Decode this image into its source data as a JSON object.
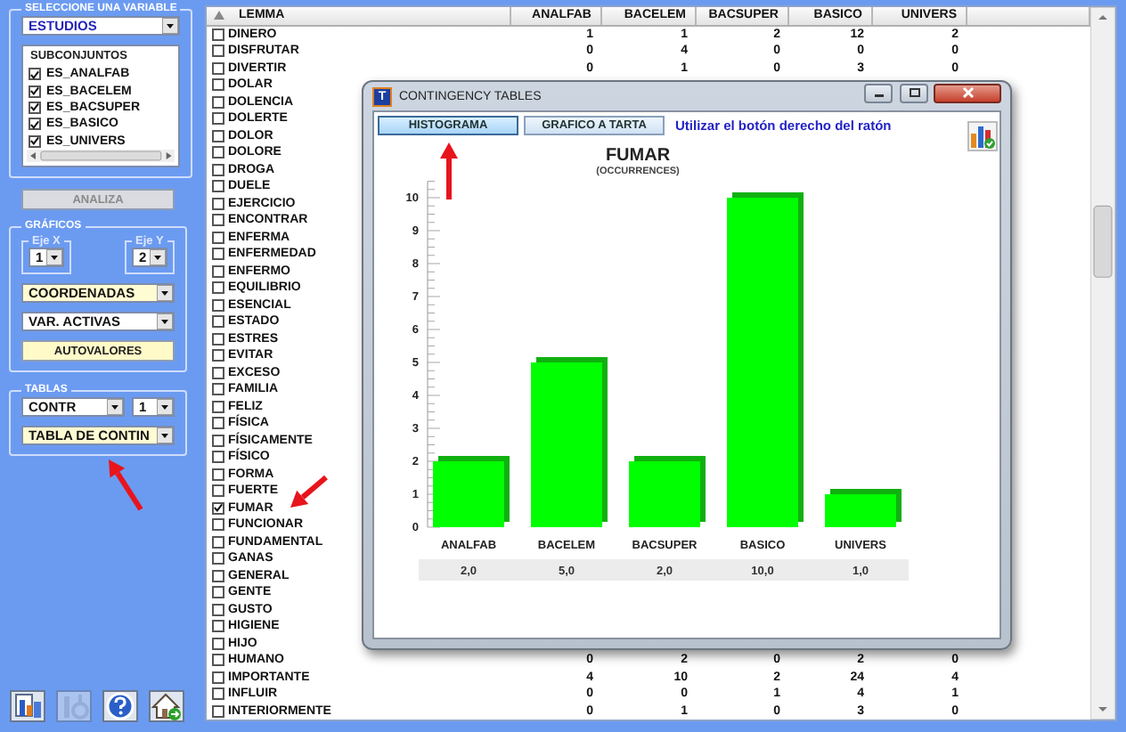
{
  "sidebar": {
    "variable_group": {
      "title": "SELECCIONE UNA VARIABLE",
      "variable": "ESTUDIOS",
      "subsets": {
        "header": "SUBCONJUNTOS",
        "items": [
          {
            "label": "ES_ANALFAB",
            "checked": true
          },
          {
            "label": "ES_BACELEM",
            "checked": true
          },
          {
            "label": "ES_BACSUPER",
            "checked": true
          },
          {
            "label": "ES_BASICO",
            "checked": true
          },
          {
            "label": "ES_UNIVERS",
            "checked": true
          }
        ]
      }
    },
    "analyze_button": {
      "label": "ANALIZA",
      "disabled": true
    },
    "charts_group": {
      "title": "GRÁFICOS",
      "axis_x": {
        "label": "Eje X",
        "value": "1"
      },
      "axis_y": {
        "label": "Eje Y",
        "value": "2"
      },
      "plot_type": {
        "value": "COORDENADAS",
        "highlighted": true
      },
      "variables": {
        "value": "VAR. ACTIVAS",
        "highlighted": false
      },
      "eigen_button": {
        "label": "AUTOVALORES"
      }
    },
    "tables_group": {
      "title": "TABLAS",
      "measure": {
        "value": "CONTR",
        "highlighted": false
      },
      "index": {
        "value": "1",
        "highlighted": false
      },
      "table_type": {
        "value": "TABLA DE CONTIN",
        "highlighted": true
      }
    },
    "toolbar": [
      {
        "kind": "export",
        "disabled": false
      },
      {
        "kind": "tool",
        "disabled": true
      },
      {
        "kind": "help",
        "disabled": false
      },
      {
        "kind": "home",
        "disabled": false
      }
    ]
  },
  "table": {
    "columns": [
      "LEMMA",
      "ANALFAB",
      "BACELEM",
      "BACSUPER",
      "BASICO",
      "UNIVERS"
    ],
    "rows": [
      {
        "lemma": "DINERO",
        "checked": false,
        "values": [
          "1",
          "1",
          "2",
          "12",
          "2"
        ]
      },
      {
        "lemma": "DISFRUTAR",
        "checked": false,
        "values": [
          "0",
          "4",
          "0",
          "0",
          "0"
        ]
      },
      {
        "lemma": "DIVERTIR",
        "checked": false,
        "values": [
          "0",
          "1",
          "0",
          "3",
          "0"
        ]
      },
      {
        "lemma": "DOLAR",
        "checked": false
      },
      {
        "lemma": "DOLENCIA",
        "checked": false
      },
      {
        "lemma": "DOLERTE",
        "checked": false
      },
      {
        "lemma": "DOLOR",
        "checked": false
      },
      {
        "lemma": "DOLORE",
        "checked": false
      },
      {
        "lemma": "DROGA",
        "checked": false
      },
      {
        "lemma": "DUELE",
        "checked": false
      },
      {
        "lemma": "EJERCICIO",
        "checked": false
      },
      {
        "lemma": "ENCONTRAR",
        "checked": false
      },
      {
        "lemma": "ENFERMA",
        "checked": false
      },
      {
        "lemma": "ENFERMEDAD",
        "checked": false
      },
      {
        "lemma": "ENFERMO",
        "checked": false
      },
      {
        "lemma": "EQUILIBRIO",
        "checked": false
      },
      {
        "lemma": "ESENCIAL",
        "checked": false
      },
      {
        "lemma": "ESTADO",
        "checked": false
      },
      {
        "lemma": "ESTRES",
        "checked": false
      },
      {
        "lemma": "EVITAR",
        "checked": false
      },
      {
        "lemma": "EXCESO",
        "checked": false
      },
      {
        "lemma": "FAMILIA",
        "checked": false
      },
      {
        "lemma": "FELIZ",
        "checked": false
      },
      {
        "lemma": "FÍSICA",
        "checked": false
      },
      {
        "lemma": "FÍSICAMENTE",
        "checked": false
      },
      {
        "lemma": "FÍSICO",
        "checked": false
      },
      {
        "lemma": "FORMA",
        "checked": false
      },
      {
        "lemma": "FUERTE",
        "checked": false
      },
      {
        "lemma": "FUMAR",
        "checked": true
      },
      {
        "lemma": "FUNCIONAR",
        "checked": false
      },
      {
        "lemma": "FUNDAMENTAL",
        "checked": false
      },
      {
        "lemma": "GANAS",
        "checked": false
      },
      {
        "lemma": "GENERAL",
        "checked": false
      },
      {
        "lemma": "GENTE",
        "checked": false
      },
      {
        "lemma": "GUSTO",
        "checked": false
      },
      {
        "lemma": "HIGIENE",
        "checked": false
      },
      {
        "lemma": "HIJO",
        "checked": false
      },
      {
        "lemma": "HUMANO",
        "checked": false,
        "values": [
          "0",
          "2",
          "0",
          "2",
          "0"
        ]
      },
      {
        "lemma": "IMPORTANTE",
        "checked": false,
        "values": [
          "4",
          "10",
          "2",
          "24",
          "4"
        ]
      },
      {
        "lemma": "INFLUIR",
        "checked": false,
        "values": [
          "0",
          "0",
          "1",
          "4",
          "1"
        ]
      },
      {
        "lemma": "INTERIORMENTE",
        "checked": false,
        "values": [
          "0",
          "1",
          "0",
          "3",
          "0"
        ]
      }
    ]
  },
  "dialog": {
    "icon_letter": "T",
    "title": "CONTINGENCY TABLES",
    "tabs": [
      {
        "label": "HISTOGRAMA",
        "selected": true
      },
      {
        "label": "GRAFICO A TARTA",
        "selected": false
      }
    ],
    "hint": "Utilizar el botón derecho del ratón",
    "chart_subtitle": "(OCCURRENCES)",
    "chart_data": {
      "type": "bar",
      "title": "FUMAR",
      "categories": [
        "ANALFAB",
        "BACELEM",
        "BACSUPER",
        "BASICO",
        "UNIVERS"
      ],
      "values": [
        2,
        5,
        2,
        10,
        1
      ],
      "ylim": [
        0,
        10.5
      ],
      "yticks": [
        0,
        1,
        2,
        3,
        4,
        5,
        6,
        7,
        8,
        9,
        10
      ],
      "value_labels": [
        "2,0",
        "5,0",
        "2,0",
        "10,0",
        "1,0"
      ]
    }
  }
}
